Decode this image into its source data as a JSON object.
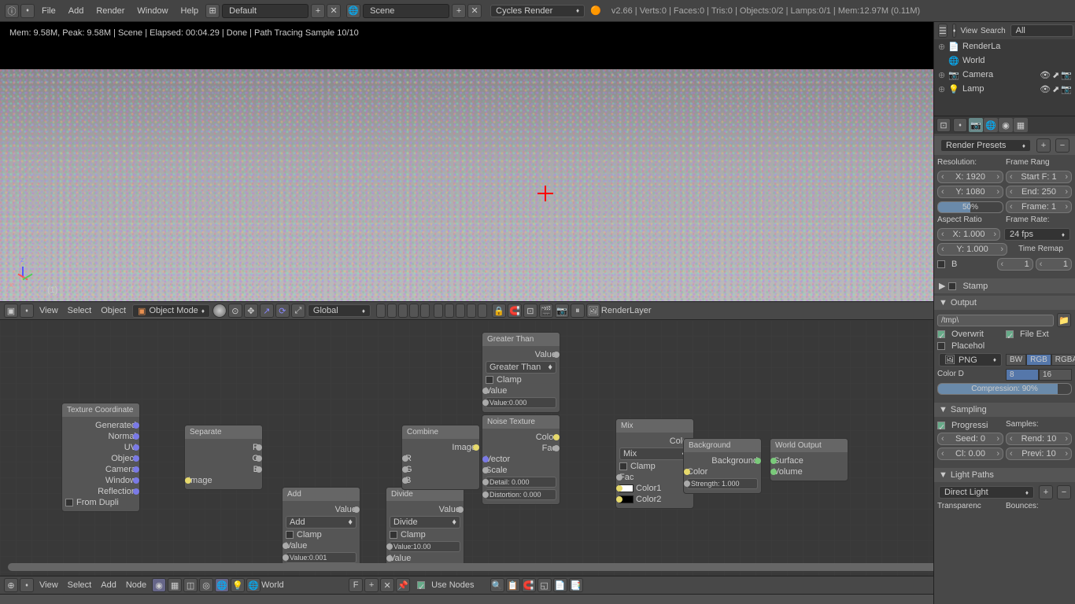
{
  "topbar": {
    "menus": [
      "File",
      "Add",
      "Render",
      "Window",
      "Help"
    ],
    "layout": "Default",
    "scene": "Scene",
    "engine": "Cycles Render",
    "status": "v2.66 | Verts:0 | Faces:0 | Tris:0 | Objects:0/2 | Lamps:0/1 | Mem:12.97M (0.11M)"
  },
  "viewport": {
    "render_info": "Mem: 9.58M, Peak: 9.58M | Scene | Elapsed: 00:04.29 | Done | Path Tracing Sample 10/10",
    "axis_labels": {
      "z": "z",
      "x": "x"
    },
    "layer_label": "(1)",
    "header": {
      "menus": [
        "View",
        "Select",
        "Object"
      ],
      "mode": "Object Mode",
      "orientation": "Global",
      "render_layer": "RenderLayer"
    }
  },
  "node_editor": {
    "header": {
      "menus": [
        "View",
        "Select",
        "Add",
        "Node"
      ],
      "material": "World",
      "use_nodes": "Use Nodes"
    },
    "nodes": {
      "tex_coord": {
        "title": "Texture Coordinate",
        "outputs": [
          "Generated",
          "Normal",
          "UV",
          "Object",
          "Camera",
          "Window",
          "Reflection"
        ],
        "from_dupli": "From Dupli"
      },
      "separate": {
        "title": "Separate",
        "in": "Image",
        "outs": [
          "R",
          "G",
          "B"
        ]
      },
      "add": {
        "title": "Add",
        "out": "Value",
        "mode": "Add",
        "clamp": "Clamp",
        "value_label": "Value",
        "value": "Value:0.001"
      },
      "divide": {
        "title": "Divide",
        "out": "Value",
        "mode": "Divide",
        "clamp": "Clamp",
        "value": "Value:10.00",
        "value_label": "Value"
      },
      "combine": {
        "title": "Combine",
        "out": "Image",
        "ins": [
          "R",
          "G",
          "B"
        ]
      },
      "greater": {
        "title": "Greater Than",
        "out": "Value",
        "mode": "Greater Than",
        "clamp": "Clamp",
        "value_label": "Value",
        "value": "Value:0.000"
      },
      "noise": {
        "title": "Noise Texture",
        "outs": [
          "Color",
          "Fac"
        ],
        "vector": "Vector",
        "scale": "Scale",
        "detail": "Detail: 0.000",
        "distortion": "Distortion: 0.000"
      },
      "mix": {
        "title": "Mix",
        "out": "Color",
        "mode": "Mix",
        "clamp": "Clamp",
        "fac": "Fac",
        "c1": "Color1",
        "c2": "Color2"
      },
      "background": {
        "title": "Background",
        "out": "Background",
        "color": "Color",
        "strength": "Strength: 1.000"
      },
      "world_out": {
        "title": "World Output",
        "surface": "Surface",
        "volume": "Volume"
      }
    }
  },
  "outliner": {
    "view": "View",
    "search": "Search",
    "all": "All",
    "items": [
      {
        "name": "RenderLa",
        "icon": "📄"
      },
      {
        "name": "World",
        "icon": "🌐"
      },
      {
        "name": "Camera",
        "icon": "📷"
      },
      {
        "name": "Lamp",
        "icon": "💡"
      }
    ]
  },
  "properties": {
    "render_presets": "Render Presets",
    "resolution": {
      "label": "Resolution:",
      "x": "X: 1920",
      "y": "Y: 1080",
      "pct": "50%"
    },
    "frame_range": {
      "label": "Frame Rang",
      "start": "Start F: 1",
      "end": "End: 250",
      "frame": "Frame: 1"
    },
    "aspect": {
      "label": "Aspect Ratio",
      "x": "X: 1.000",
      "y": "Y: 1.000",
      "border": "B"
    },
    "frame_rate": {
      "label": "Frame Rate:",
      "fps": "24 fps",
      "remap": "Time Remap",
      "r1": "1",
      "r2": "1"
    },
    "stamp": "Stamp",
    "output": {
      "label": "Output",
      "path": "/tmp\\",
      "overwrite": "Overwrit",
      "file_ext": "File Ext",
      "placehol": "Placehol",
      "format": "PNG",
      "bw": "BW",
      "rgb": "RGB",
      "rgba": "RGBA",
      "color_d": "Color D",
      "cd1": "8",
      "cd2": "16",
      "compression": "Compression: 90%"
    },
    "sampling": {
      "label": "Sampling",
      "progressive": "Progressi",
      "samples": "Samples:",
      "seed": "Seed: 0",
      "render": "Rend: 10",
      "cl": "Cl: 0.00",
      "preview": "Previ: 10"
    },
    "light_paths": {
      "label": "Light Paths",
      "preset": "Direct Light",
      "trans": "Transparenc",
      "bounces": "Bounces:"
    }
  }
}
